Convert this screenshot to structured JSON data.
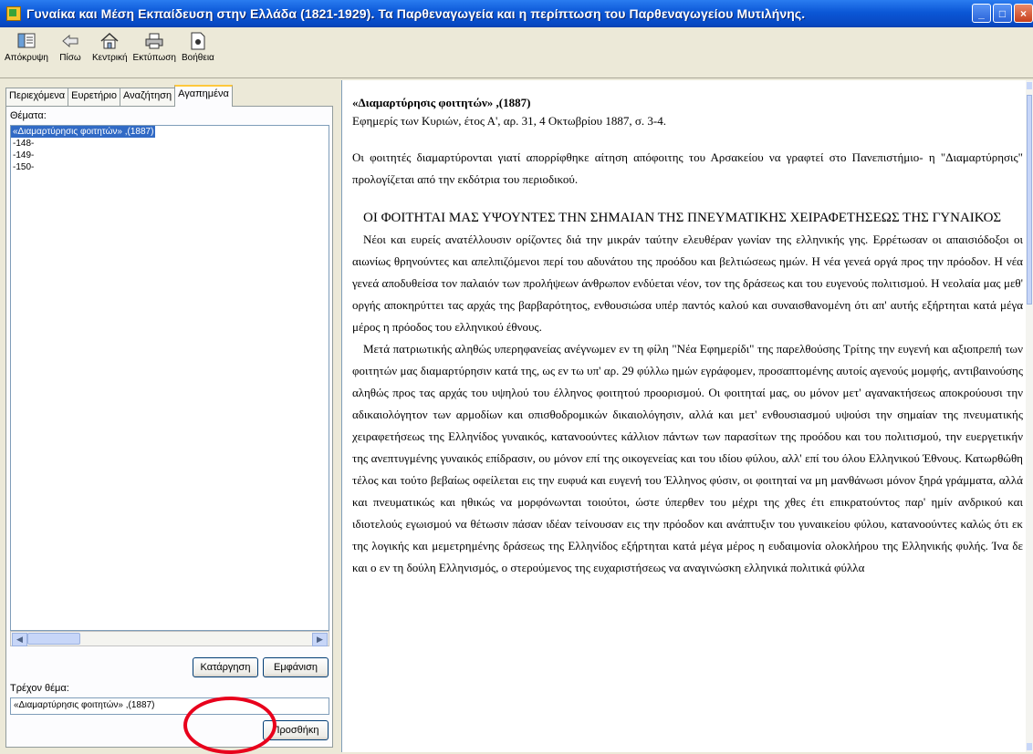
{
  "window": {
    "title": "Γυναίκα και Μέση Εκπαίδευση στην Ελλάδα (1821-1929). Τα Παρθεναγωγεία και η περίπτωση του Παρθεναγωγείου Μυτιλήνης.",
    "controls": [
      "_",
      "□",
      "×"
    ]
  },
  "toolbar": {
    "buttons": [
      {
        "label": "Απόκρυψη",
        "icon": "hide-icon"
      },
      {
        "label": "Πίσω",
        "icon": "back-arrow-icon"
      },
      {
        "label": "Κεντρική",
        "icon": "home-icon"
      },
      {
        "label": "Εκτύπωση",
        "icon": "printer-icon"
      },
      {
        "label": "Βοήθεια",
        "icon": "help-icon"
      }
    ]
  },
  "sidebar": {
    "tabs": [
      "Περιεχόμενα",
      "Ευρετήριο",
      "Αναζήτηση",
      "Αγαπημένα"
    ],
    "active_tab": "Αγαπημένα",
    "topics_label": "Θέματα:",
    "topics": [
      "«Διαμαρτύρησις φοιτητών» ,(1887)",
      "-148-",
      "-149-",
      "-150-"
    ],
    "remove_button": "Κατάργηση",
    "show_button": "Εμφάνιση",
    "current_topic_label": "Τρέχον θέμα:",
    "current_topic_value": "«Διαμαρτύρησις φοιτητών» ,(1887)",
    "add_button": "Προσθήκη"
  },
  "document": {
    "heading": "«Διαμαρτύρησις φοιτητών» ,(1887)",
    "source": "Εφημερίς των Κυριών, έτος Α', αρ. 31, 4 Οκτωβρίου 1887, σ. 3-4.",
    "summary": "Οι φοιτητές διαμαρτύρονται γιατί απορρίφθηκε αίτηση απόφοιτης του Αρσακείου να γραφτεί στο Πανεπιστήμιο- η \"Διαμαρτύρησις\" προλογίζεται από την εκδότρια του περιοδικού.",
    "article_title": "ΟΙ ΦΟΙΤΗΤΑΙ ΜΑΣ ΥΨΟΥΝΤΕΣ ΤΗΝ ΣΗΜΑΙΑΝ ΤΗΣ ΠΝΕΥΜΑΤΙΚΗΣ ΧΕΙΡΑΦΕΤΗΣΕΩΣ ΤΗΣ ΓΥΝΑΙΚΟΣ",
    "paragraph1": "Νέοι και ευρείς ανατέλλουσιν ορίζοντες διά την μικράν ταύτην ελευθέραν γωνίαν της ελληνικής γης. Ερρέτωσαν οι απαισιόδοξοι οι αιωνίως θρηνούντες και απελπιζόμενοι περί του αδυνάτου της προόδου και βελτιώσεως ημών. Η νέα γενεά οργά προς την πρόοδον. Η νέα γενεά αποδυθείσα τον παλαιόν των προλήψεων άνθρωπον ενδύεται νέον, τον της δράσεως και του ευγενούς πολιτισμού. Η νεολαία μας μεθ' οργής αποκηρύττει τας αρχάς της βαρβαρότητος, ενθουσιώσα υπέρ παντός καλού και συναισθανομένη ότι απ' αυτής εξήρτηται κατά μέγα μέρος η πρόοδος του ελληνικού έθνους.",
    "paragraph2": "Μετά πατριωτικής αληθώς υπερηφανείας ανέγνωμεν εν τη φίλη \"Νέα Εφημερίδι\" της παρελθούσης Τρίτης την ευγενή και αξιοπρεπή των φοιτητών μας διαμαρτύρησιν κατά της, ως εν τω υπ' αρ. 29 φύλλω ημών εγράφομεν, προσαπτομένης αυτοίς αγενούς μομφής, αντιβαινούσης αληθώς προς τας αρχάς του υψηλού του έλληνος φοιτητού προορισμού. Οι φοιτηταί μας, ου μόνον μετ' αγανακτήσεως αποκρούουσι την αδικαιολόγητον των αρμοδίων και οπισθοδρομικών δικαιολόγησιν, αλλά και μετ' ενθουσιασμού υψούσι την σημαίαν της πνευματικής χειραφετήσεως της Ελληνίδος γυναικός, κατανοούντες κάλλιον πάντων των παρασίτων της προόδου και του πολιτισμού, την ευεργετικήν της ανεπτυγμένης γυναικός επίδρασιν, ου μόνον επί της οικογενείας και του ιδίου φύλου, αλλ' επί του όλου Ελληνικού Έθνους. Κατωρθώθη τέλος και τούτο βεβαίως οφείλεται εις την ευφυά και ευγενή του Έλληνος φύσιν, οι φοιτηταί να μη μανθάνωσι μόνον ξηρά γράμματα, αλλά και πνευματικώς και ηθικώς να μορφόνωνται τοιούτοι, ώστε ύπερθεν του μέχρι της χθες έτι επικρατούντος παρ' ημίν ανδρικού και ιδιοτελούς εγωισμού να θέτωσιν πάσαν ιδέαν τείνουσαν εις την πρόοδον και ανάπτυξιν του γυναικείου φύλου, κατανοούντες καλώς ότι εκ της λογικής και μεμετρημένης δράσεως της Ελληνίδος εξήρτηται κατά μέγα μέρος η ευδαιμονία ολοκλήρου της Ελληνικής φυλής. Ίνα δε και ο εν τη δούλη Ελληνισμός, ο στερούμενος της ευχαριστήσεως να αναγινώσκη ελληνικά πολιτικά φύλλα"
  },
  "colors": {
    "title_bar": "#0b57d6",
    "selection": "#316ac5",
    "annotation_circle": "#e8001c",
    "window_bg": "#ece9d8"
  }
}
